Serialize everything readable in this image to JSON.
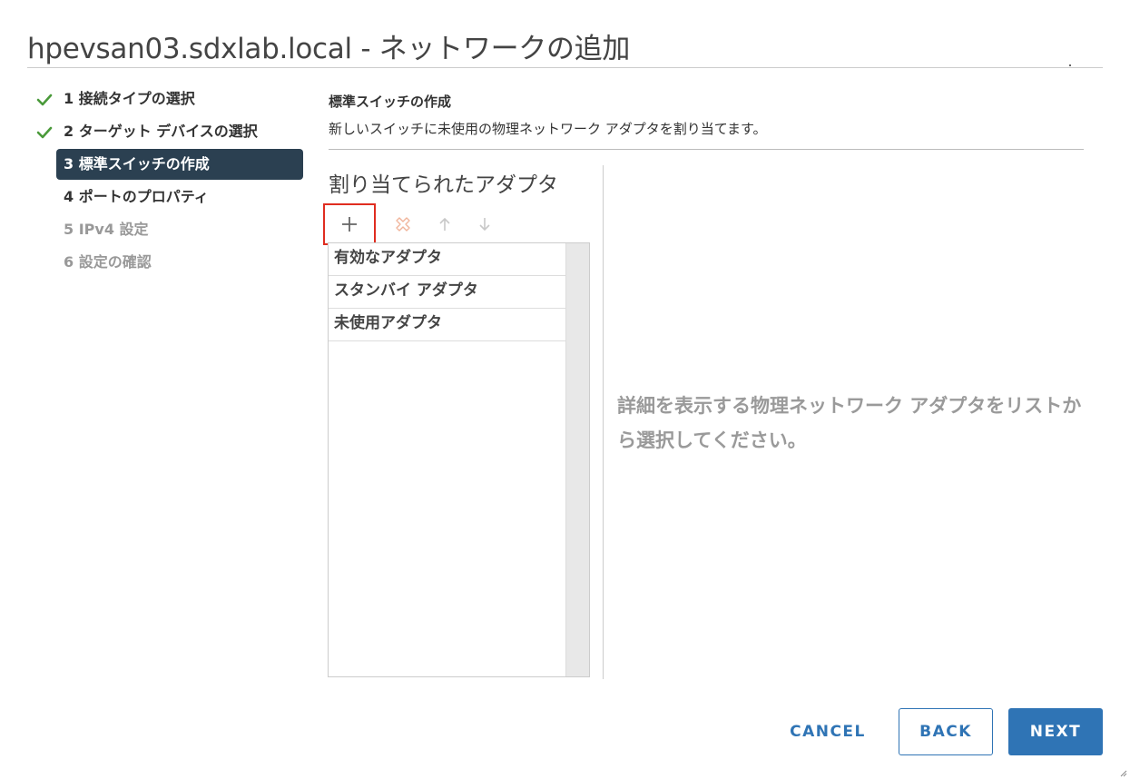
{
  "dialog": {
    "title": "hpevsan03.sdxlab.local - ネットワークの追加"
  },
  "steps": [
    {
      "label": "1 接続タイプの選択",
      "state": "completed"
    },
    {
      "label": "2 ターゲット デバイスの選択",
      "state": "completed"
    },
    {
      "label": "3 標準スイッチの作成",
      "state": "active"
    },
    {
      "label": "4 ポートのプロパティ",
      "state": "pending"
    },
    {
      "label": "5 IPv4 設定",
      "state": "disabled"
    },
    {
      "label": "6 設定の確認",
      "state": "disabled"
    }
  ],
  "content": {
    "section_title": "標準スイッチの作成",
    "section_desc": "新しいスイッチに未使用の物理ネットワーク アダプタを割り当てます。",
    "assigned_title": "割り当てられたアダプタ",
    "toolbar": {
      "add_icon": "plus-icon",
      "remove_icon": "remove-x-icon",
      "up_icon": "arrow-up-icon",
      "down_icon": "arrow-down-icon"
    },
    "adapter_groups": [
      "有効なアダプタ",
      "スタンバイ アダプタ",
      "未使用アダプタ"
    ],
    "detail_placeholder": "詳細を表示する物理ネットワーク アダプタをリストから選択してください。"
  },
  "footer": {
    "cancel_label": "CANCEL",
    "back_label": "BACK",
    "next_label": "NEXT"
  },
  "colors": {
    "accent": "#2f74b5",
    "active_step_bg": "#2b4051",
    "check_green": "#4a9a3a",
    "highlight_red": "#e02d20"
  }
}
